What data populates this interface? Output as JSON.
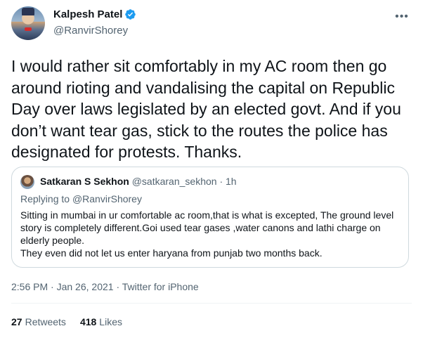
{
  "author": {
    "name": "Kalpesh Patel",
    "handle": "@RanvirShorey",
    "verified": true
  },
  "tweet": {
    "text": "I would rather sit comfortably in my AC room then go around rioting and vandalising the capital on Republic Day over laws legislated by an elected govt. And if you don’t want tear gas, stick to the routes the police has designated for protests. Thanks."
  },
  "quote": {
    "name": "Satkaran S Sekhon",
    "handle": "@satkaran_sekhon",
    "time": "· 1h",
    "replying_prefix": "Replying to",
    "replying_to": "@RanvirShorey",
    "body_line1": "Sitting in mumbai in ur comfortable ac room,that is what is excepted, The ground level story is completely different.Goi used tear gases ,water canons and lathi charge on elderly people.",
    "body_line2": "They even did not let us enter haryana from punjab two months back."
  },
  "meta": {
    "time": "2:56 PM",
    "date": "Jan 26, 2021",
    "source": "Twitter for iPhone"
  },
  "stats": {
    "retweets_count": "27",
    "retweets_label": "Retweets",
    "likes_count": "418",
    "likes_label": "Likes"
  },
  "colors": {
    "verified": "#1d9bf0",
    "secondary_text": "#536471",
    "border": "#cfd9de"
  },
  "icons": {
    "verified": "verified-badge-icon",
    "more": "more-options-icon"
  }
}
